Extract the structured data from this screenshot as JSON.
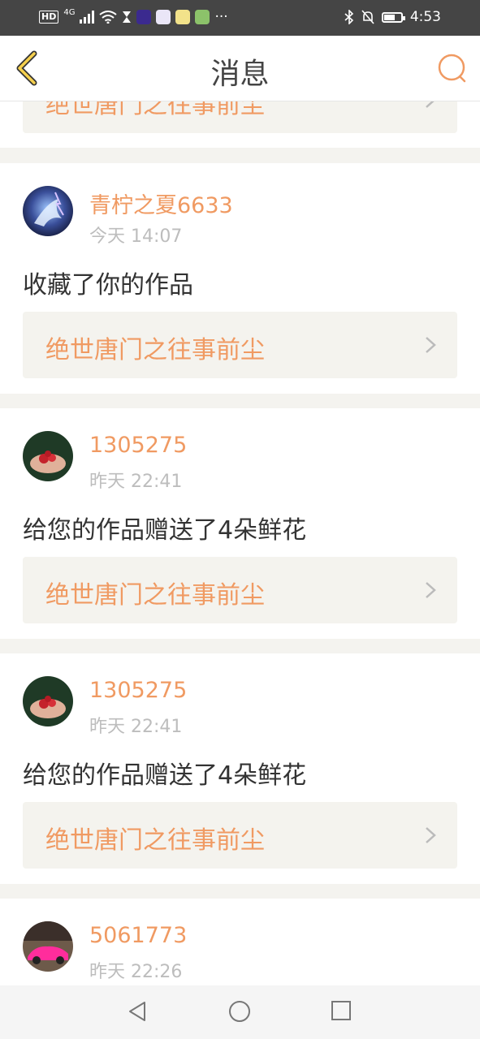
{
  "status_bar": {
    "hd": "HD",
    "network": "4G",
    "time": "4:53",
    "more": "···",
    "battery_level": 0.65
  },
  "nav": {
    "title": "消息"
  },
  "messages": [
    {
      "username": "",
      "time": "",
      "action": "",
      "work_title": "绝世唐门之往事前尘"
    },
    {
      "username": "青柠之夏6633",
      "time": "今天 14:07",
      "action": "收藏了你的作品",
      "work_title": "绝世唐门之往事前尘"
    },
    {
      "username": "1305275",
      "time": "昨天 22:41",
      "action": "给您的作品赠送了4朵鲜花",
      "work_title": "绝世唐门之往事前尘"
    },
    {
      "username": "1305275",
      "time": "昨天 22:41",
      "action": "给您的作品赠送了4朵鲜花",
      "work_title": "绝世唐门之往事前尘"
    },
    {
      "username": "5061773",
      "time": "昨天 22:26",
      "action": "",
      "work_title": ""
    }
  ],
  "colors": {
    "accent": "#f09a62",
    "back_icon": "#e9c24a",
    "feed_background": "#f4f3ef"
  }
}
